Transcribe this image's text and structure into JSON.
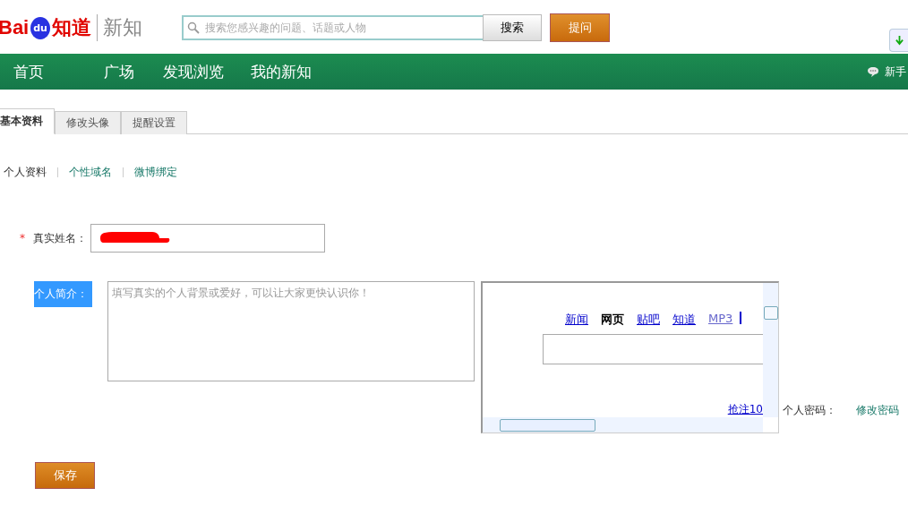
{
  "logo": {
    "latin": "Bai",
    "paw": "du",
    "cn": "知道",
    "product": "新知"
  },
  "search": {
    "placeholder": "搜索您感兴趣的问题、话题或人物",
    "button": "搜索"
  },
  "ask_button": "提问",
  "nav": {
    "items": [
      "首页",
      "广场",
      "发现浏览",
      "我的新知"
    ],
    "help": "新手"
  },
  "tabs": [
    {
      "label": "基本资料",
      "selected": true
    },
    {
      "label": "修改头像",
      "selected": false
    },
    {
      "label": "提醒设置",
      "selected": false
    }
  ],
  "sublinks": [
    {
      "label": "个人资料",
      "selected": true
    },
    {
      "label": "个性域名",
      "selected": false
    },
    {
      "label": "微博绑定",
      "selected": false
    }
  ],
  "form": {
    "name_label": "真实姓名：",
    "required_mark": "*",
    "intro_label": "个人简介：",
    "intro_label_highlighted": true,
    "intro_placeholder": "填写真实的个人背景或爱好，可以让大家更快认识你！",
    "password_label": "个人密码：",
    "password_link": "修改密码",
    "save": "保存"
  },
  "embedded_page": {
    "links": [
      {
        "label": "新闻",
        "selected": false
      },
      {
        "label": "网页",
        "selected": true
      },
      {
        "label": "贴吧",
        "selected": false
      },
      {
        "label": "知道",
        "selected": false
      },
      {
        "label": "MP3",
        "selected": false
      }
    ],
    "bottom_link": "抢注10"
  }
}
